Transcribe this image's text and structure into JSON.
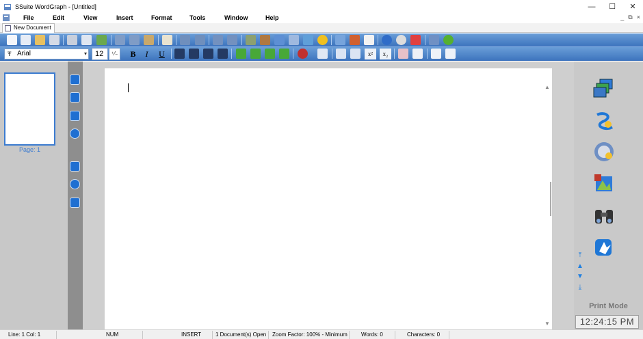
{
  "window": {
    "title": "SSuite WordGraph - [Untitled]",
    "minimize_glyph": "—",
    "maximize_glyph": "☐",
    "close_glyph": "✕"
  },
  "menu": {
    "items": [
      "File",
      "Edit",
      "View",
      "Insert",
      "Format",
      "Tools",
      "Window",
      "Help"
    ],
    "mdi_minimize": "_",
    "mdi_restore": "⧉",
    "mdi_close": "×"
  },
  "tabs": [
    "New Document"
  ],
  "format_bar": {
    "font_name": "Arial",
    "font_size": "12",
    "size_spin": "⁺⁄₋",
    "bold": "B",
    "italic": "I",
    "underline": "U",
    "superscript": "x²",
    "subscript": "x₂"
  },
  "thumbnails": {
    "page_label": "Page: 1"
  },
  "right_panel": {
    "mode_label": "Print Mode",
    "clock": "12:24:15 PM"
  },
  "status": {
    "line_col": "Line:  1  Col:  1",
    "num": "NUM",
    "insert": "INSERT",
    "docs_open": "1 Document(s) Open",
    "zoom": "Zoom Factor: 100% - Minimum",
    "words": "Words: 0",
    "characters": "Characters: 0"
  },
  "colors": {
    "toolbar_top": "#6a9ed8",
    "toolbar_bottom": "#3c73bd",
    "accent": "#3b7bd0",
    "icon_blue": "#1f6fd1"
  }
}
